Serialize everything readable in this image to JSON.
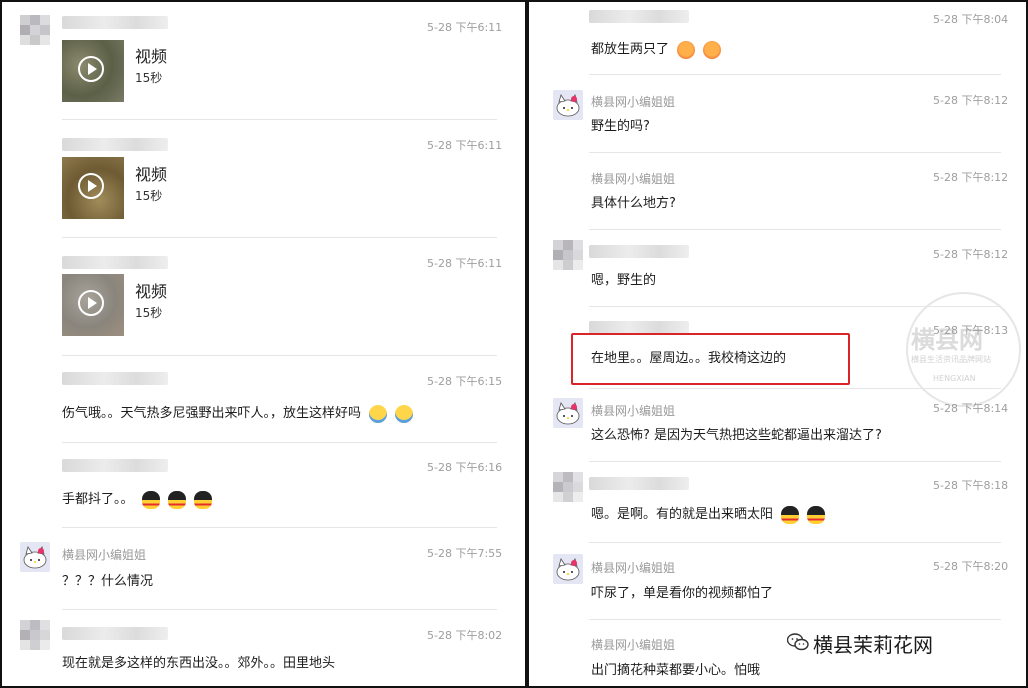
{
  "left": {
    "messages": [
      {
        "time": "5-28 下午6:11",
        "video_label": "视频",
        "duration": "15秒"
      },
      {
        "time": "5-28 下午6:11",
        "video_label": "视频",
        "duration": "15秒"
      },
      {
        "time": "5-28 下午6:11",
        "video_label": "视频",
        "duration": "15秒"
      },
      {
        "time": "5-28 下午6:15",
        "text": "伤气哦。。天气热多尼强野出来吓人。，放生这样好吗"
      },
      {
        "time": "5-28 下午6:16",
        "text": "手都抖了。。"
      },
      {
        "sender": "横县网小编姐姐",
        "time": "5-28 下午7:55",
        "text": "？？？什么情况"
      },
      {
        "time": "5-28 下午8:02",
        "text": "现在就是多这样的东西出没。。郊外。。田里地头"
      }
    ]
  },
  "right": {
    "messages": [
      {
        "time": "5-28 下午8:04",
        "text": "都放生两只了"
      },
      {
        "sender": "横县网小编姐姐",
        "time": "5-28 下午8:12",
        "text": "野生的吗?"
      },
      {
        "sender": "横县网小编姐姐",
        "time": "5-28 下午8:12",
        "text": "具体什么地方?"
      },
      {
        "time": "5-28 下午8:12",
        "text": "嗯，野生的"
      },
      {
        "time": "5-28 下午8:13",
        "text": "在地里。。屋周边。。我校椅这边的"
      },
      {
        "sender": "横县网小编姐姐",
        "time": "5-28 下午8:14",
        "text": "这么恐怖? 是因为天气热把这些蛇都逼出来溜达了?"
      },
      {
        "time": "5-28 下午8:18",
        "text": "嗯。是啊。有的就是出来晒太阳"
      },
      {
        "sender": "横县网小编姐姐",
        "time": "5-28 下午8:20",
        "text": "吓尿了，单是看你的视频都怕了"
      },
      {
        "sender": "横县网小编姐姐",
        "text": "出门摘花种菜都要小心。怕哦"
      }
    ],
    "watermark": {
      "main": "横县网",
      "sub": "横县生活资讯品牌网站",
      "latin": "HENGXIAN"
    },
    "brand": "横县茉莉花网"
  },
  "colors": {
    "highlight": "#d9242a",
    "time": "#9e9e9e",
    "text": "#1c1c1c"
  }
}
